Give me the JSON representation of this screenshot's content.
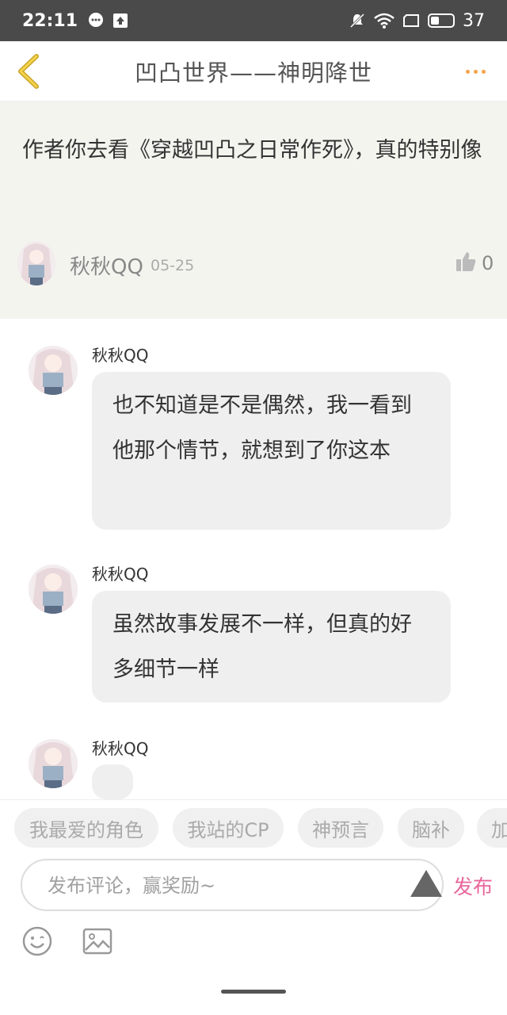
{
  "status_bar": {
    "time": "22:11",
    "battery": "37"
  },
  "nav": {
    "title": "凹凸世界——神明降世"
  },
  "main_comment": {
    "text": "作者你去看《穿越凹凸之日常作死》，真的特别像",
    "author": "秋秋QQ",
    "date": "05-25",
    "likes": "0"
  },
  "replies": [
    {
      "author": "秋秋QQ",
      "text": "也不知道是不是偶然，我一看到他那个情节，就想到了你这本"
    },
    {
      "author": "秋秋QQ",
      "text": "虽然故事发展不一样，但真的好多细节一样"
    },
    {
      "author": "秋秋QQ",
      "text": ""
    }
  ],
  "tags": [
    "我最爱的角色",
    "我站的CP",
    "神预言",
    "脑补",
    "加"
  ],
  "input": {
    "placeholder": "发布评论，赢奖励~",
    "publish_label": "发布"
  },
  "colors": {
    "accent_orange": "#f5a24a",
    "publish_pink": "#e9659b",
    "status_bar_bg": "#4a4a4a",
    "main_comment_bg": "#f4f4ef"
  }
}
